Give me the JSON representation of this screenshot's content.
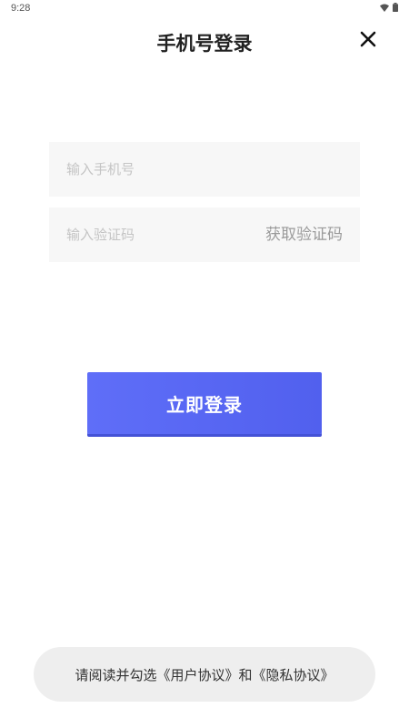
{
  "status_bar": {
    "time": "9:28",
    "icons": [
      "wifi-icon",
      "battery-icon"
    ]
  },
  "header": {
    "title": "手机号登录",
    "close_icon": "close-icon"
  },
  "form": {
    "phone_placeholder": "输入手机号",
    "phone_value": "",
    "code_placeholder": "输入验证码",
    "code_value": "",
    "get_code_label": "获取验证码"
  },
  "login_button": {
    "label": "立即登录",
    "color": "#5b69f5"
  },
  "toast": {
    "message": "请阅读并勾选《用户协议》和《隐私协议》"
  }
}
